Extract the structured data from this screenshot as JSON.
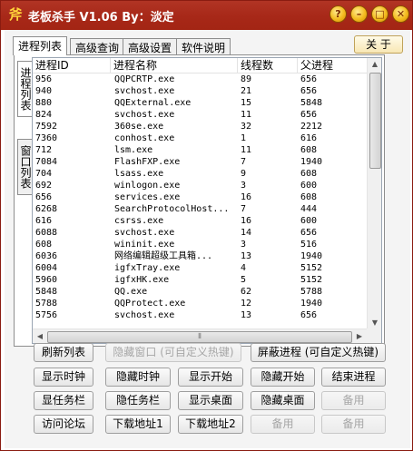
{
  "window": {
    "title": "老板杀手 V1.06 By：淡定",
    "icon_glyph": "斧",
    "controls": {
      "help": "?",
      "minimize": "–",
      "maximize": "□",
      "close": "✕"
    }
  },
  "tabs": [
    "进程列表",
    "高级查询",
    "高级设置",
    "软件说明"
  ],
  "about_button": "关 于",
  "side_tabs": [
    "进程列表",
    "窗口列表"
  ],
  "table": {
    "headers": [
      "进程ID",
      "进程名称",
      "线程数",
      "父进程"
    ],
    "rows": [
      [
        "956",
        "QQPCRTP.exe",
        "89",
        "656"
      ],
      [
        "940",
        "svchost.exe",
        "21",
        "656"
      ],
      [
        "880",
        "QQExternal.exe",
        "15",
        "5848"
      ],
      [
        "824",
        "svchost.exe",
        "11",
        "656"
      ],
      [
        "7592",
        "360se.exe",
        "32",
        "2212"
      ],
      [
        "7360",
        "conhost.exe",
        "1",
        "616"
      ],
      [
        "712",
        "lsm.exe",
        "11",
        "608"
      ],
      [
        "7084",
        "FlashFXP.exe",
        "7",
        "1940"
      ],
      [
        "704",
        "lsass.exe",
        "9",
        "608"
      ],
      [
        "692",
        "winlogon.exe",
        "3",
        "600"
      ],
      [
        "656",
        "services.exe",
        "16",
        "608"
      ],
      [
        "6268",
        "SearchProtocolHost...",
        "7",
        "444"
      ],
      [
        "616",
        "csrss.exe",
        "16",
        "600"
      ],
      [
        "6088",
        "svchost.exe",
        "14",
        "656"
      ],
      [
        "608",
        "wininit.exe",
        "3",
        "516"
      ],
      [
        "6036",
        "网络编辑超级工具箱...",
        "13",
        "1940"
      ],
      [
        "6004",
        "igfxTray.exe",
        "4",
        "5152"
      ],
      [
        "5960",
        "igfxHK.exe",
        "5",
        "5152"
      ],
      [
        "5848",
        "QQ.exe",
        "62",
        "5788"
      ],
      [
        "5788",
        "QQProtect.exe",
        "12",
        "1940"
      ],
      [
        "5756",
        "svchost.exe",
        "13",
        "656"
      ]
    ]
  },
  "buttons": {
    "refresh_list": "刷新列表",
    "hide_window": "隐藏窗口 (可自定义热键)",
    "block_process": "屏蔽进程 (可自定义热键)",
    "show_clock": "显示时钟",
    "hide_clock": "隐藏时钟",
    "show_start": "显示开始",
    "hide_start": "隐藏开始",
    "end_process": "结束进程",
    "show_taskbar": "显任务栏",
    "hide_taskbar": "隐任务栏",
    "show_desktop": "显示桌面",
    "hide_desktop": "隐藏桌面",
    "spare_1": "备用",
    "visit_forum": "访问论坛",
    "download_1": "下载地址1",
    "download_2": "下载地址2",
    "spare_2": "备用",
    "spare_3": "备用"
  },
  "colors": {
    "title_bar": "#a72818",
    "window_button": "#f3bb1e"
  }
}
